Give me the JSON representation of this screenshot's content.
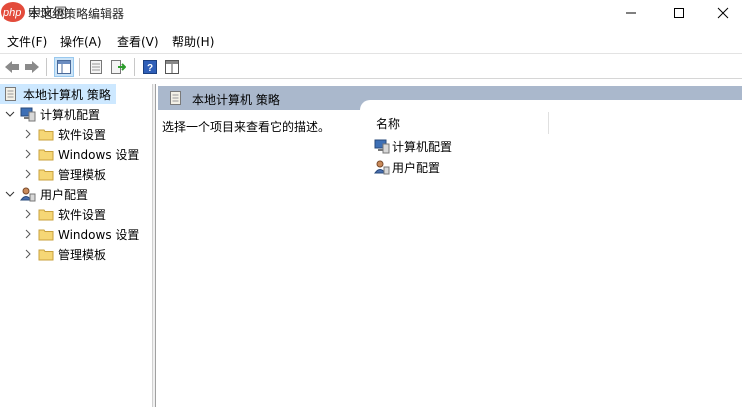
{
  "window": {
    "title": "本地组策略编辑器",
    "watermark": "php 中文网"
  },
  "menu": {
    "items": [
      "文件(F)",
      "操作(A)",
      "查看(V)",
      "帮助(H)"
    ]
  },
  "tree": {
    "root": "本地计算机 策略",
    "computer": {
      "label": "计算机配置",
      "children": [
        "软件设置",
        "Windows 设置",
        "管理模板"
      ]
    },
    "user": {
      "label": "用户配置",
      "children": [
        "软件设置",
        "Windows 设置",
        "管理模板"
      ]
    }
  },
  "right": {
    "header": "本地计算机 策略",
    "description": "选择一个项目来查看它的描述。",
    "column_name": "名称",
    "items": [
      "计算机配置",
      "用户配置"
    ]
  },
  "colors": {
    "header_bg": "#aab8cc",
    "selected_bg": "#cde8ff",
    "folder": "#e8c35a"
  }
}
